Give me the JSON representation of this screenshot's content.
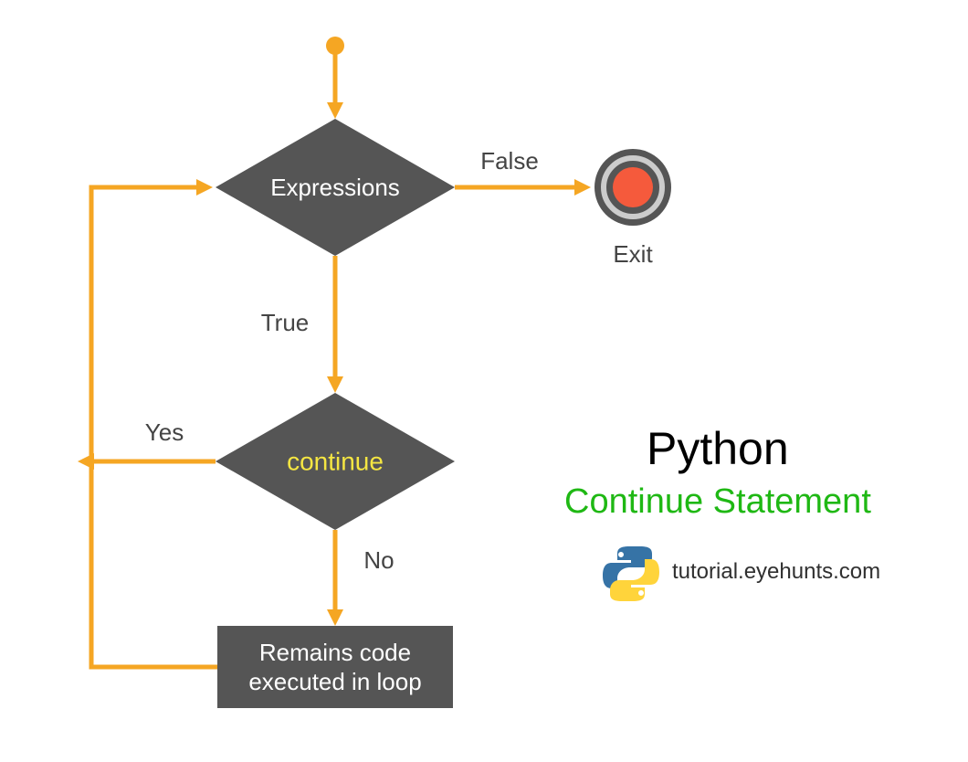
{
  "labels": {
    "expressions": "Expressions",
    "continue": "continue",
    "remains_line1": "Remains code",
    "remains_line2": "executed in loop",
    "false": "False",
    "exit": "Exit",
    "true": "True",
    "yes": "Yes",
    "no": "No"
  },
  "title": {
    "python": "Python",
    "continue_statement": "Continue Statement",
    "website": "tutorial.eyehunts.com"
  },
  "colors": {
    "flow": "#f5a623",
    "node": "#555555",
    "accent_yellow": "#f5e642",
    "green": "#1fb814",
    "exit_red": "#f55a3c"
  },
  "diagram": {
    "type": "flowchart",
    "nodes": [
      {
        "id": "start",
        "type": "start"
      },
      {
        "id": "expressions",
        "type": "decision",
        "text": "Expressions"
      },
      {
        "id": "continue",
        "type": "decision",
        "text": "continue"
      },
      {
        "id": "remains",
        "type": "process",
        "text": "Remains code executed in loop"
      },
      {
        "id": "exit",
        "type": "terminator",
        "text": "Exit"
      }
    ],
    "edges": [
      {
        "from": "start",
        "to": "expressions"
      },
      {
        "from": "expressions",
        "to": "exit",
        "label": "False"
      },
      {
        "from": "expressions",
        "to": "continue",
        "label": "True"
      },
      {
        "from": "continue",
        "to": "expressions",
        "label": "Yes"
      },
      {
        "from": "continue",
        "to": "remains",
        "label": "No"
      },
      {
        "from": "remains",
        "to": "expressions"
      }
    ]
  }
}
